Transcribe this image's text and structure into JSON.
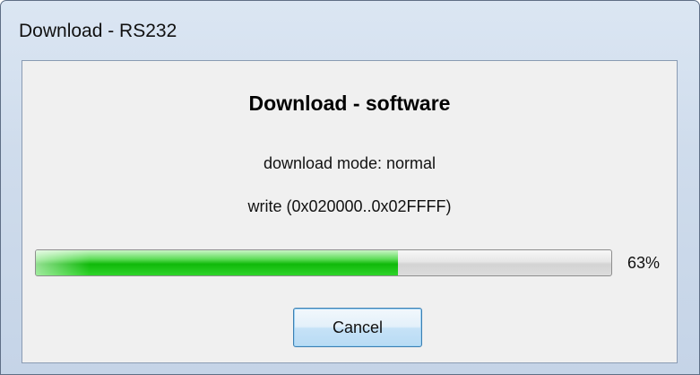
{
  "window": {
    "title": "Download - RS232"
  },
  "dialog": {
    "heading": "Download - software",
    "mode_line": "download mode: normal",
    "write_line": "write  (0x020000..0x02FFFF)",
    "progress": {
      "value_percent": 63,
      "label": "63%"
    },
    "cancel_label": "Cancel"
  },
  "colors": {
    "progress_fill": "#10b90a",
    "button_border": "#3c7fb1"
  }
}
